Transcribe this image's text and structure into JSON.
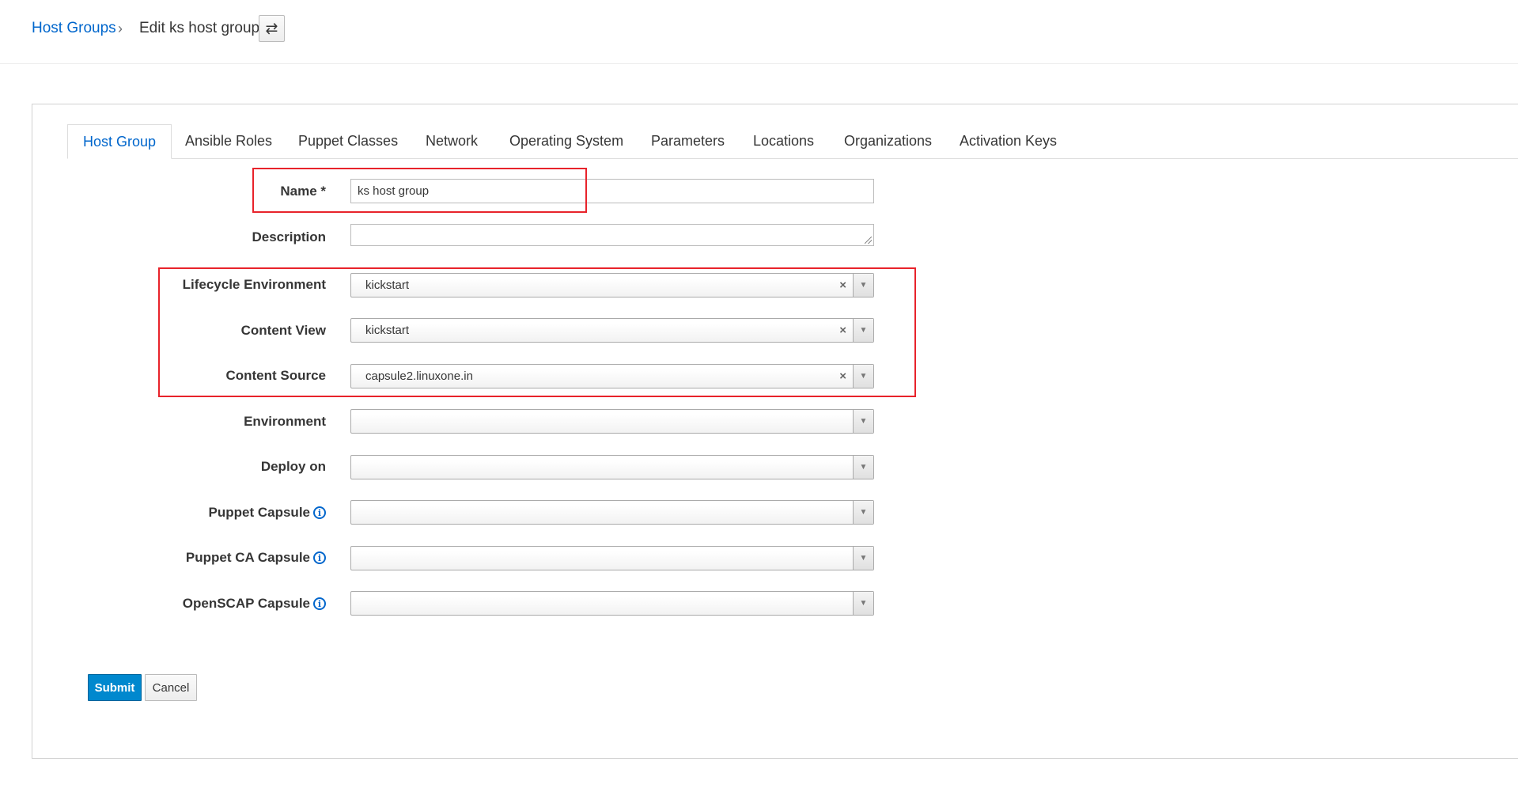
{
  "breadcrumb": {
    "parent": "Host Groups",
    "separator": "›",
    "current": "Edit ks host group",
    "switcher_icon": "⇄"
  },
  "tabs": [
    {
      "label": "Host Group",
      "active": true
    },
    {
      "label": "Ansible Roles"
    },
    {
      "label": "Puppet Classes"
    },
    {
      "label": "Network"
    },
    {
      "label": "Operating System"
    },
    {
      "label": "Parameters"
    },
    {
      "label": "Locations"
    },
    {
      "label": "Organizations"
    },
    {
      "label": "Activation Keys"
    }
  ],
  "form": {
    "name": {
      "label": "Name *",
      "value": "ks host group"
    },
    "description": {
      "label": "Description",
      "value": ""
    },
    "lifecycle_environment": {
      "label": "Lifecycle Environment",
      "value": "kickstart"
    },
    "content_view": {
      "label": "Content View",
      "value": "kickstart"
    },
    "content_source": {
      "label": "Content Source",
      "value": "capsule2.linuxone.in"
    },
    "environment": {
      "label": "Environment",
      "value": ""
    },
    "deploy_on": {
      "label": "Deploy on",
      "value": ""
    },
    "puppet_capsule": {
      "label": "Puppet Capsule",
      "value": ""
    },
    "puppet_ca_capsule": {
      "label": "Puppet CA Capsule",
      "value": ""
    },
    "openscap_capsule": {
      "label": "OpenSCAP Capsule",
      "value": ""
    },
    "clear_glyph": "×",
    "arrow_glyph": "▼",
    "info_glyph": "i"
  },
  "buttons": {
    "submit": "Submit",
    "cancel": "Cancel"
  },
  "colors": {
    "link": "#0066cc",
    "primary": "#0088ce",
    "highlight": "#e8232b"
  }
}
